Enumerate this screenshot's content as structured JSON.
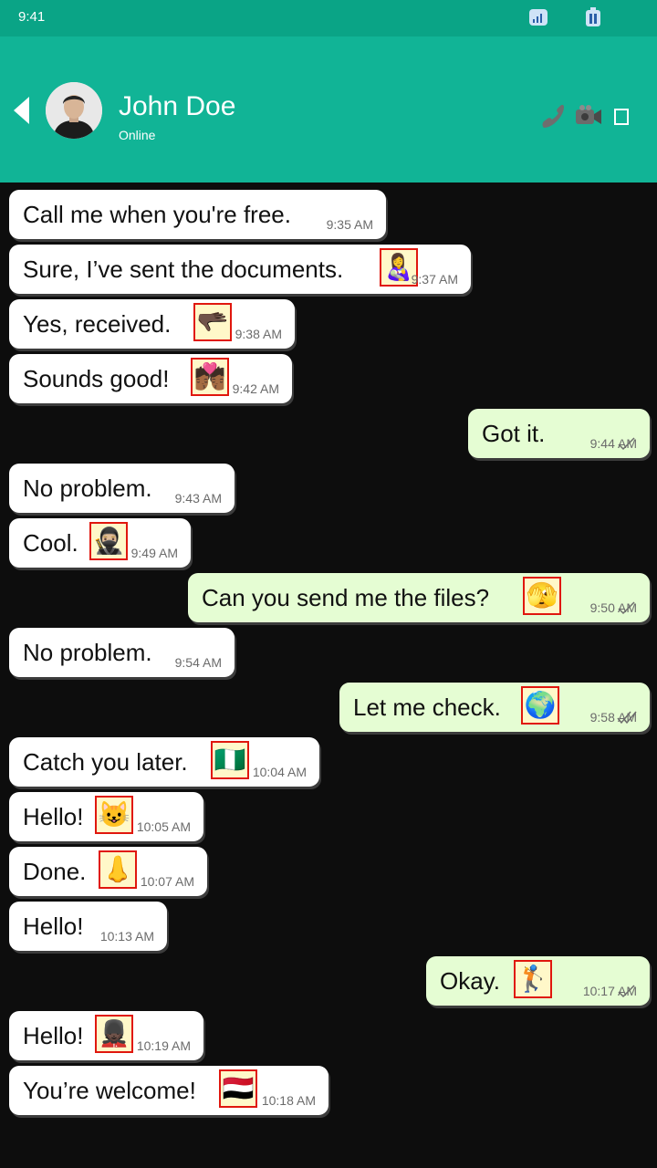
{
  "status_bar": {
    "time": "9:41"
  },
  "header": {
    "name": "John Doe",
    "status": "Online"
  },
  "messages": [
    {
      "text": "Call me when you're free.",
      "time": "9:35 AM"
    },
    {
      "text": "Sure, I’ve sent the documents.",
      "time": "9:37 AM",
      "emoji": "👩‍🍼"
    },
    {
      "text": "Yes, received.",
      "time": "9:38 AM",
      "emoji": "🫳🏿"
    },
    {
      "text": "Sounds good!",
      "time": "9:42 AM",
      "emoji": "💏🏾"
    },
    {
      "text": "Got it.",
      "time": "9:44 AM"
    },
    {
      "text": "No problem.",
      "time": "9:43 AM"
    },
    {
      "text": "Cool.",
      "time": "9:49 AM",
      "emoji": "🥷🏼"
    },
    {
      "text": "Can you send me the files?",
      "time": "9:50 AM",
      "emoji": "🫣"
    },
    {
      "text": "No problem.",
      "time": "9:54 AM"
    },
    {
      "text": "Let me check.",
      "time": "9:58 AM",
      "emoji": "🌍"
    },
    {
      "text": "Catch you later.",
      "time": "10:04 AM",
      "emoji": "🇳🇬"
    },
    {
      "text": "Hello!",
      "time": "10:05 AM",
      "emoji": "😺"
    },
    {
      "text": "Done.",
      "time": "10:07 AM",
      "emoji": "👃"
    },
    {
      "text": "Hello!",
      "time": "10:13 AM"
    },
    {
      "text": "Okay.",
      "time": "10:17 AM",
      "emoji": "🏌️"
    },
    {
      "text": "Hello!",
      "time": "10:19 AM",
      "emoji": "💂🏿"
    },
    {
      "text": "You’re welcome!",
      "time": "10:18 AM",
      "emoji": "🇾🇪"
    }
  ],
  "colors": {
    "header": "#11b496",
    "status_bar": "#0aa486",
    "incoming_bubble": "#ffffff",
    "outgoing_bubble": "#e5fdd3",
    "emoji_border": "#e0170e"
  }
}
